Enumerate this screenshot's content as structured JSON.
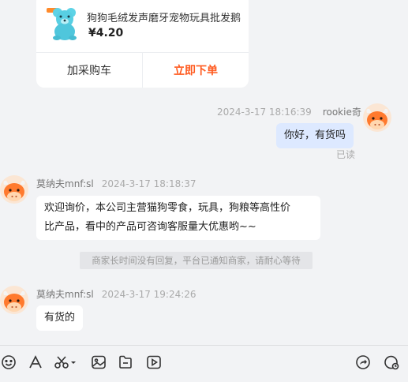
{
  "product_card": {
    "title": "狗狗毛绒发声磨牙宠物玩具批发鹅",
    "price": "¥4.20",
    "add_to_cart_label": "加采购车",
    "order_now_label": "立即下单"
  },
  "messages": [
    {
      "sender": "rookie奇",
      "time": "2024-3-17 18:16:39",
      "text": "你好，有货吗",
      "status": "已读"
    },
    {
      "sender": "莫纳夫mnf:sl",
      "time": "2024-3-17 18:18:37",
      "lines": [
        "欢迎询价，本公司主营猫狗零食，玩具，狗粮等高性价",
        "比产品，看中的产品可咨询客服量大优惠哟~~"
      ]
    },
    {
      "sender": "莫纳夫mnf:sl",
      "time": "2024-3-17 19:24:26",
      "text": "有货的"
    }
  ],
  "system_notice": "商家长时间没有回复，平台已通知商家，请耐心等待",
  "toolbar": {
    "left_icons": [
      "emoji-icon",
      "font-icon",
      "scissors-icon",
      "image-icon",
      "file-icon",
      "video-icon"
    ],
    "right_icons": [
      "share-icon",
      "chat-history-icon"
    ]
  },
  "colors": {
    "accent_orange": "#ff5a1f",
    "mine_bubble": "#dde9ff",
    "background": "#f2f3f5"
  }
}
